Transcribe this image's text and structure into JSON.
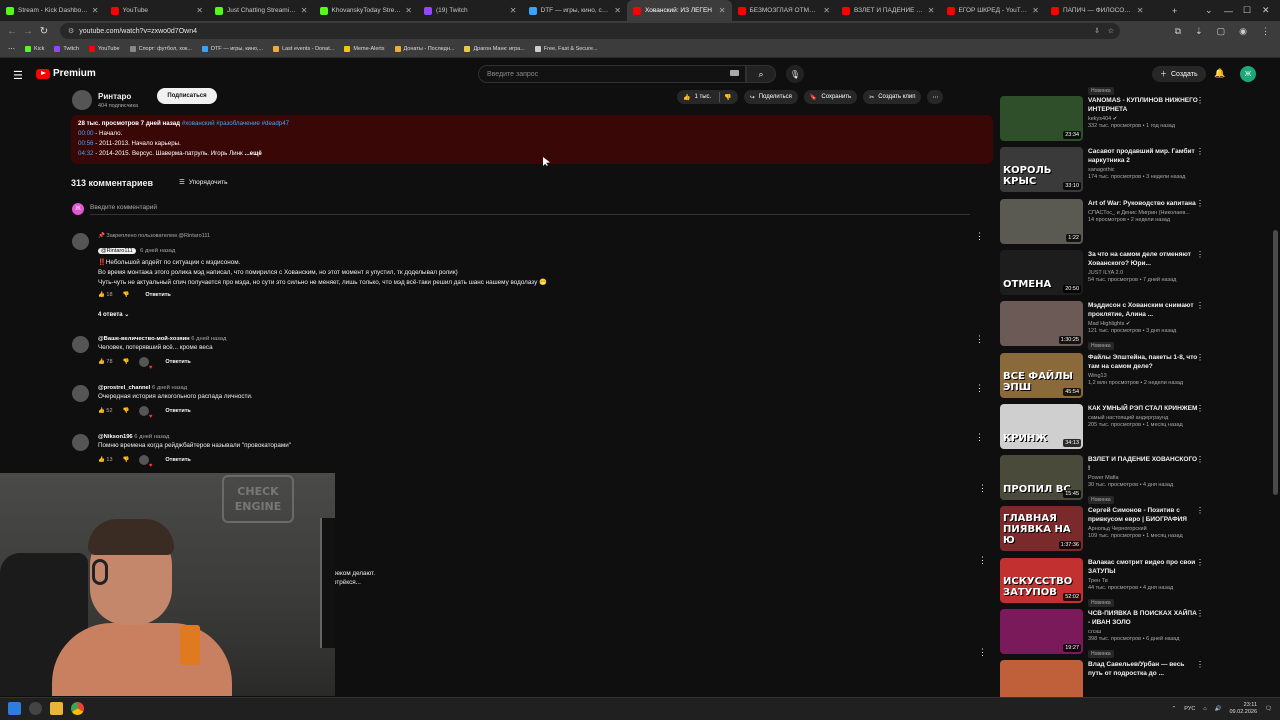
{
  "browser": {
    "tabs": [
      {
        "title": "Stream - Kick Dashboard",
        "color": "#53fc18"
      },
      {
        "title": "YouTube",
        "color": "#ff0000"
      },
      {
        "title": "Just Chatting Streaming -",
        "color": "#53fc18"
      },
      {
        "title": "KhovanskyToday Stream -",
        "color": "#53fc18"
      },
      {
        "title": "(19) Twitch",
        "color": "#9146ff"
      },
      {
        "title": "DTF — игры, кино, сериа",
        "color": "#3aa3ff"
      },
      {
        "title": "Хованский: ИЗ ЛЕГЕН",
        "color": "#ff0000"
      },
      {
        "title": "БЕЗМОЗГЛАЯ ОТМЕНА Х",
        "color": "#ff0000"
      },
      {
        "title": "ВЗЛЕТ И ПАДЕНИЕ ХОВ",
        "color": "#ff0000"
      },
      {
        "title": "ЕГОР ШКРЕД - YouTube",
        "color": "#ff0000"
      },
      {
        "title": "ПАПИЧ — ФИЛОСОФИЯ",
        "color": "#ff0000"
      }
    ],
    "new_tab": "+",
    "url": "youtube.com/watch?v=zxwo0d7Own4",
    "bookmarks": [
      {
        "label": "Kick",
        "color": "#53fc18"
      },
      {
        "label": "Twitch",
        "color": "#9146ff"
      },
      {
        "label": "YouTube",
        "color": "#ff0000"
      },
      {
        "label": "Спорт: футбол, хок...",
        "color": "#888888"
      },
      {
        "label": "DTF — игры, кино,...",
        "color": "#3aa3ff"
      },
      {
        "label": "Last events - Donat...",
        "color": "#f1a93b"
      },
      {
        "label": "Meme-Alerts",
        "color": "#f7c600"
      },
      {
        "label": "Донаты - Последн...",
        "color": "#f1a93b"
      },
      {
        "label": "Драгон Манк: игра...",
        "color": "#e8c94b"
      },
      {
        "label": "Free, Fast & Secure...",
        "color": "#cccccc"
      }
    ]
  },
  "yt": {
    "logo_text": "Premium",
    "search_placeholder": "Введите запрос",
    "create_label": "Создать",
    "avatar_letter": "Ж"
  },
  "video": {
    "channel_name": "Ринтаро",
    "subscribers": "404 подписчика",
    "subscribe_label": "Подписаться",
    "likes": "1 тыс.",
    "share_label": "Поделиться",
    "save_label": "Сохранить",
    "clip_label": "Создать клип",
    "desc_stats": "28 тыс. просмотров  7 дней назад",
    "desc_tags": "#хованский #разоблачение #deadp47",
    "chapters": [
      {
        "time": "00:00",
        "text": " - Начало."
      },
      {
        "time": "00:56",
        "text": " - 2011-2013. Начало карьеры."
      },
      {
        "time": "04:32",
        "text": " - 2014-2015. Версус. Шаверма-патруль. Игорь Линк"
      }
    ],
    "more_label": "...ещё"
  },
  "comments": {
    "count_label": "313 комментариев",
    "sort_label": "Упорядочить",
    "input_placeholder": "Введите комментарий",
    "my_avatar": "Ж",
    "pinned": {
      "pinned_by": "Закреплено пользователем @Rintaro111",
      "author": "@Rintaro111",
      "time": "6 дней назад",
      "lines": [
        "‼️Небольшой апдейт по ситуации с мэдисоном.",
        "Во время монтажа этого ролика мэд написал, что помирился с Хованским, но этот момент я упустил, тк доделывал ролик)",
        "Чуть-чуть не актуальный спич получается про мэда, но сути это сильно не меняет, лишь только, что мэд всё-таки решил дать шанс нашему водолазу 😁"
      ],
      "likes": "18",
      "reply_label": "Ответить",
      "replies_label": "4 ответа"
    },
    "items": [
      {
        "author": "@Ваше-величество-мой-хозяин",
        "time": "6 дней назад",
        "text": "Человек, потерявший всё... кроме веса",
        "likes": "78",
        "reply_label": "Ответить"
      },
      {
        "author": "@prostrel_channel",
        "time": "6 дней назад",
        "text": "Очередная история алкогольного распада личности.",
        "likes": "52",
        "reply_label": "Ответить"
      },
      {
        "author": "@Nikson196",
        "time": "6 дней назад",
        "text": "Помню времена когда рейджбайтеров называли \"провокаторами\"",
        "likes": "13",
        "reply_label": "Ответить"
      }
    ],
    "partial_lines": [
      "реком делают.",
      " отрёкся..."
    ]
  },
  "sidebar": {
    "top_badge": "Новинка",
    "videos": [
      {
        "title": "VANOMAS - КУПЛИНОВ НИЖНЕГО ИНТЕРНЕТА",
        "channel": "kekys404 ✔",
        "meta": "332 тыс. просмотров • 1 год назад",
        "duration": "23:34",
        "thumb_text": "",
        "bg": "#2f4f2a",
        "badge": ""
      },
      {
        "title": "Сасавот продавший мир. Гамбит наркутника 2",
        "channel": "sanagothic",
        "meta": "174 тыс. просмотров • 3 недели назад",
        "duration": "33:10",
        "thumb_text": "КОРОЛЬ КРЫС",
        "bg": "#3a3a3a",
        "badge": ""
      },
      {
        "title": "Art of War: Руководство капитана",
        "channel": "СПАСТос_ и Денис Мигрин (Николаев...",
        "meta": "14 просмотров • 2 недели назад",
        "duration": "1:22",
        "thumb_text": "",
        "bg": "#5a5a52",
        "badge": ""
      },
      {
        "title": "За что на самом деле отменяют Хованского? Юри...",
        "channel": "JUST ILYA 2.0",
        "meta": "54 тыс. просмотров • 7 дней назад",
        "duration": "20:50",
        "thumb_text": "ОТМЕНА",
        "bg": "#1d1d1d",
        "badge": ""
      },
      {
        "title": "Мэддисон с Хованским снимают проклятие, Алина ...",
        "channel": "Mad Highlights ✔",
        "meta": "121 тыс. просмотров • 3 дня назад",
        "duration": "1:30:25",
        "thumb_text": "",
        "bg": "#6b5a55",
        "badge": "Новинка"
      },
      {
        "title": "Файлы Эпштейна, пакеты 1-8, что там на самом деле?",
        "channel": "Wing13",
        "meta": "1,2 млн просмотров • 2 недели назад",
        "duration": "45:54",
        "thumb_text": "ВСЕ ФАЙЛЫ ЭПШ",
        "bg": "#8a6a3a",
        "badge": ""
      },
      {
        "title": "КАК УМНЫЙ РЭП СТАЛ КРИНЖЕМ",
        "channel": "самый настоящий андерграунд",
        "meta": "205 тыс. просмотров • 1 месяц назад",
        "duration": "34:13",
        "thumb_text": "КРИНЖ",
        "bg": "#cfcfcf",
        "badge": ""
      },
      {
        "title": "ВЗЛЕТ И ПАДЕНИЕ ХОВАНСКОГО !",
        "channel": "Power Mafia",
        "meta": "30 тыс. просмотров • 4 дня назад",
        "duration": "15:45",
        "thumb_text": "ПРОПИЛ ВС",
        "bg": "#4a4a3a",
        "badge": "Новинка"
      },
      {
        "title": "Сергей Симонов - Позитив с привкусом евро | БИОГРАФИЯ",
        "channel": "Арнольд Черногорский",
        "meta": "109 тыс. просмотров • 1 месяц назад",
        "duration": "1:37:36",
        "thumb_text": "ГЛАВНАЯ ПИЯВКА НА Ю",
        "bg": "#7a2a2a",
        "badge": ""
      },
      {
        "title": "Валакас смотрит видео про свои ЗАТУПЫ",
        "channel": "Трен Тв",
        "meta": "44 тыс. просмотров • 4 дня назад",
        "duration": "52:02",
        "thumb_text": "ИСКУССТВО ЗАТУПОВ",
        "bg": "#c23030",
        "badge": "Новинка"
      },
      {
        "title": "ЧСВ-ПИЯВКА В ПОИСКАХ ХАЙПА - ИВАН ЗОЛО",
        "channel": "слэш",
        "meta": "398 тыс. просмотров • 6 дней назад",
        "duration": "19:27",
        "thumb_text": "",
        "bg": "#7a1a5a",
        "badge": "Новинка"
      },
      {
        "title": "Влад Савельев/Урбан — весь путь от подростка до ...",
        "channel": "",
        "meta": "",
        "duration": "",
        "thumb_text": "",
        "bg": "#c0603a",
        "badge": ""
      }
    ]
  },
  "webcam": {
    "sign_text": "CHECK ENGINE"
  },
  "taskbar": {
    "lang": "РУС",
    "time": "23:11",
    "date": "09.02.2026"
  }
}
